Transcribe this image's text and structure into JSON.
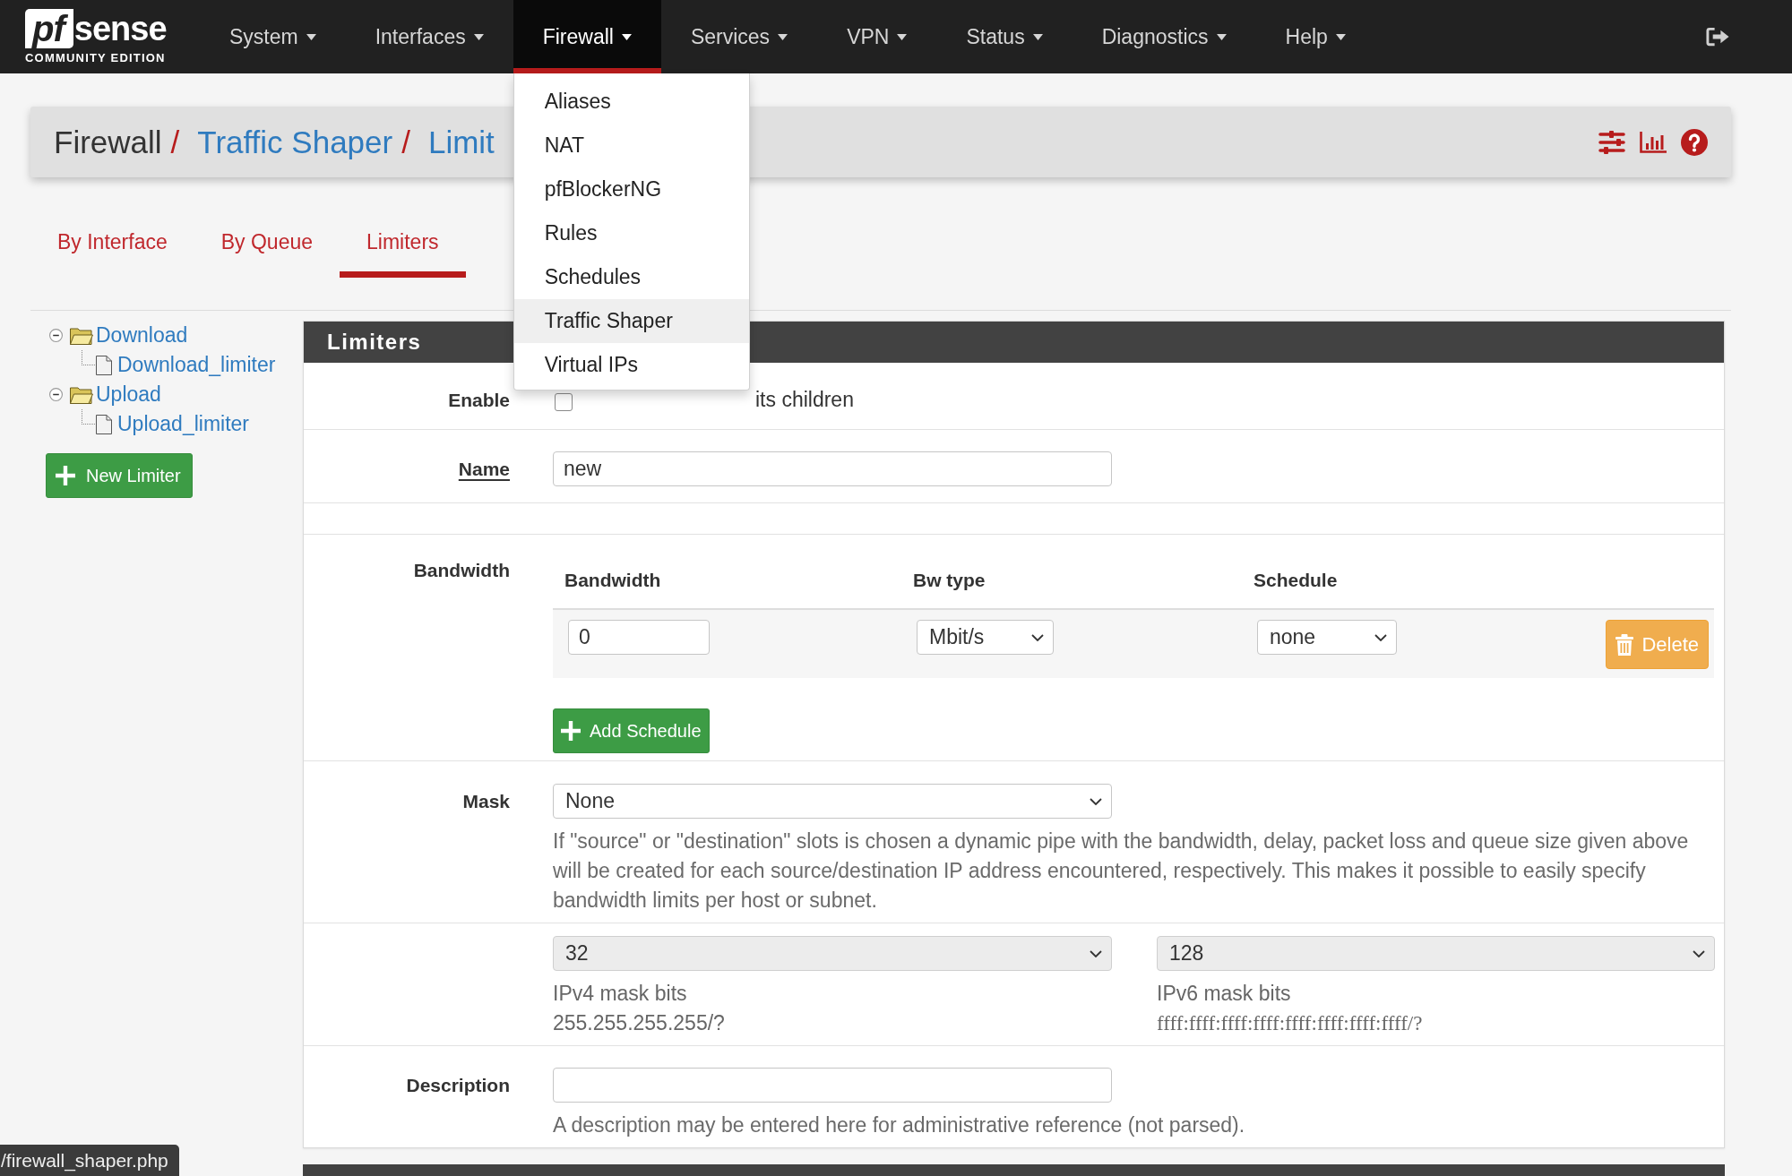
{
  "navbar": {
    "logo": {
      "mark": "pf",
      "name": "sense",
      "edition": "COMMUNITY EDITION"
    },
    "menus": [
      {
        "label": "System",
        "expanded": false
      },
      {
        "label": "Interfaces",
        "expanded": false
      },
      {
        "label": "Firewall",
        "expanded": true,
        "items": [
          {
            "label": "Aliases",
            "selected": false
          },
          {
            "label": "NAT",
            "selected": false
          },
          {
            "label": "pfBlockerNG",
            "selected": false
          },
          {
            "label": "Rules",
            "selected": false
          },
          {
            "label": "Schedules",
            "selected": false
          },
          {
            "label": "Traffic Shaper",
            "selected": true
          },
          {
            "label": "Virtual IPs",
            "selected": false
          }
        ]
      },
      {
        "label": "Services",
        "expanded": false
      },
      {
        "label": "VPN",
        "expanded": false
      },
      {
        "label": "Status",
        "expanded": false
      },
      {
        "label": "Diagnostics",
        "expanded": false
      },
      {
        "label": "Help",
        "expanded": false
      }
    ]
  },
  "breadcrumb": [
    {
      "label": "Firewall",
      "kind": "title"
    },
    {
      "separator": "/",
      "label": "Traffic Shaper",
      "kind": "link"
    },
    {
      "separator": "/",
      "label": "Limit",
      "kind": "link"
    }
  ],
  "tabs": [
    {
      "label": "By Interface",
      "selected": false
    },
    {
      "label": "By Queue",
      "selected": false
    },
    {
      "label": "Limiters",
      "selected": true
    }
  ],
  "tree": [
    {
      "label": "Download",
      "expanded": true,
      "children": [
        {
          "label": "Download_limiter"
        }
      ]
    },
    {
      "label": "Upload",
      "expanded": true,
      "children": [
        {
          "label": "Upload_limiter"
        }
      ]
    }
  ],
  "new_button": {
    "label": "New Limiter"
  },
  "panel": {
    "title": "Limiters",
    "fields": [
      {
        "kind": "checkbox",
        "label": "Enable",
        "checked": false,
        "text": "its children"
      },
      {
        "kind": "input",
        "label": "Name",
        "required": true,
        "value": "new"
      },
      {
        "kind": "bandwidth",
        "label": "Bandwidth",
        "columns": [
          "Bandwidth",
          "Bw type",
          "Schedule"
        ],
        "rows": [
          {
            "bandwidth": "0",
            "bw_type": "Mbit/s",
            "schedule": "none",
            "delete": "Delete"
          }
        ],
        "add_button": "Add Schedule"
      },
      {
        "kind": "select",
        "label": "Mask",
        "value": "None",
        "help": "If \"source\" or \"destination\" slots is chosen a dynamic pipe with the bandwidth, delay, packet loss and queue size given above will be created for each source/destination IP address encountered, respectively. This makes it possible to easily specify bandwidth limits per host or subnet."
      },
      {
        "kind": "mask_bits",
        "selects": [
          {
            "value": "32",
            "disabled": true,
            "caption": "IPv4 mask bits",
            "hint": "255.255.255.255/?"
          },
          {
            "value": "128",
            "disabled": true,
            "caption": "IPv6 mask bits",
            "hint": "ffff:ffff:ffff:ffff:ffff:ffff:ffff:ffff/?"
          }
        ]
      },
      {
        "kind": "input",
        "label": "Description",
        "required": false,
        "help": "A description may be entered here for administrative reference (not parsed)."
      }
    ]
  },
  "status_url": "/firewall_shaper.php"
}
